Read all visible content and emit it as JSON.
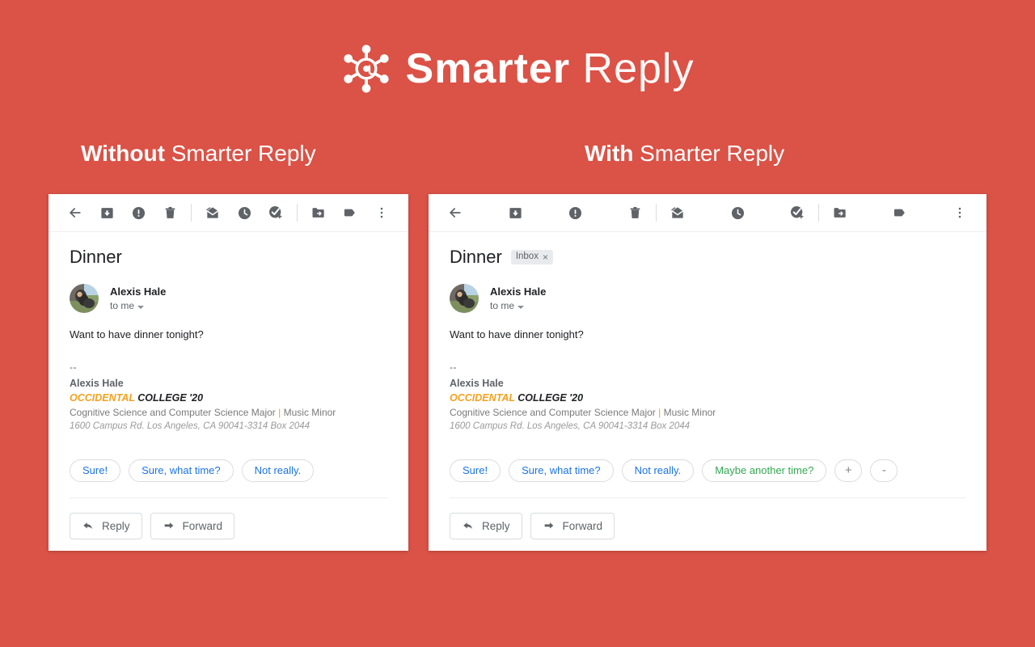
{
  "theme": {
    "background": "#DB5246",
    "chip_blue": "#1a73e8",
    "chip_green": "#34a853",
    "accent_orange": "#F5A11E"
  },
  "brand": {
    "logo_icon": "at-network-icon",
    "name_bold": "Smarter",
    "name_light": "Reply"
  },
  "columns": [
    {
      "id": "without",
      "heading_bold": "Without",
      "heading_light": "Smarter Reply",
      "show_label_chip": false,
      "smart_replies": [
        {
          "text": "Sure!",
          "color": "blue"
        },
        {
          "text": "Sure, what time?",
          "color": "blue"
        },
        {
          "text": "Not really.",
          "color": "blue"
        }
      ]
    },
    {
      "id": "with",
      "heading_bold": "With",
      "heading_light": "Smarter Reply",
      "show_label_chip": true,
      "smart_replies": [
        {
          "text": "Sure!",
          "color": "blue"
        },
        {
          "text": "Sure, what time?",
          "color": "blue"
        },
        {
          "text": "Not really.",
          "color": "blue"
        },
        {
          "text": "Maybe another time?",
          "color": "green"
        },
        {
          "text": "+",
          "color": "icon"
        },
        {
          "text": "-",
          "color": "icon"
        }
      ]
    }
  ],
  "toolbar": {
    "items": [
      {
        "name": "back-icon",
        "label": "Back"
      },
      {
        "name": "archive-icon",
        "label": "Archive"
      },
      {
        "name": "report-spam-icon",
        "label": "Report spam"
      },
      {
        "name": "delete-icon",
        "label": "Delete"
      },
      {
        "name": "mark-unread-icon",
        "label": "Mark as unread"
      },
      {
        "name": "snooze-icon",
        "label": "Snooze"
      },
      {
        "name": "add-to-tasks-icon",
        "label": "Add to tasks"
      },
      {
        "name": "move-to-icon",
        "label": "Move to"
      },
      {
        "name": "labels-icon",
        "label": "Labels"
      },
      {
        "name": "more-options-icon",
        "label": "More"
      }
    ]
  },
  "email": {
    "subject": "Dinner",
    "label_chip": "Inbox",
    "label_chip_close": "×",
    "sender_name": "Alexis Hale",
    "recipient": "to me",
    "body": "Want to have dinner tonight?",
    "signature": {
      "dashes": "--",
      "name": "Alexis Hale",
      "school_accent": "OCCIDENTAL",
      "school_rest": "COLLEGE '20",
      "major_left": "Cognitive Science and Computer Science Major",
      "major_pipe": "|",
      "major_right": "Music Minor",
      "address": "1600 Campus Rd. Los Angeles, CA 90041-3314 Box 2044"
    }
  },
  "actions": {
    "reply": "Reply",
    "forward": "Forward"
  }
}
